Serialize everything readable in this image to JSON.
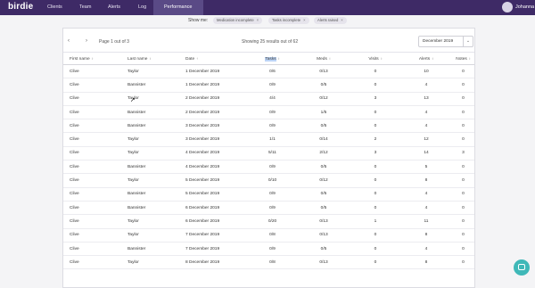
{
  "app": {
    "logo": "birdie",
    "user": "Johanna"
  },
  "nav": {
    "items": [
      "Clients",
      "Team",
      "Alerts",
      "Log",
      "Performance"
    ],
    "active": "Performance"
  },
  "filters": {
    "label": "Show me:",
    "chips": [
      "Medication incomplete",
      "Tasks incomplete",
      "Alerts raised"
    ]
  },
  "pager": {
    "prev_icon": "‹",
    "next_icon": "›",
    "text": "Page 1 out of 3",
    "showing": "Showing 25 results out of 62",
    "month": "December 2019",
    "month_caret": "⌄"
  },
  "table": {
    "headers": [
      "First name",
      "Last name",
      "Date",
      "Tasks",
      "Meds",
      "Visits",
      "Alerts",
      "Notes"
    ],
    "sort_icon": "↕",
    "date_sort_icon": "↑",
    "rows": [
      [
        "Clive",
        "Taylor",
        "1 December 2019",
        "0/6",
        "0/13",
        "0",
        "10",
        "0"
      ],
      [
        "Clive",
        "Bannister",
        "1 December 2019",
        "0/9",
        "0/5",
        "0",
        "4",
        "0"
      ],
      [
        "Clive",
        "Taylor",
        "2 December 2019",
        "4/4",
        "0/12",
        "3",
        "13",
        "0"
      ],
      [
        "Clive",
        "Bannister",
        "2 December 2019",
        "0/9",
        "1/5",
        "0",
        "4",
        "0"
      ],
      [
        "Clive",
        "Bannister",
        "3 December 2019",
        "0/9",
        "0/5",
        "0",
        "4",
        "0"
      ],
      [
        "Clive",
        "Taylor",
        "3 December 2019",
        "1/1",
        "0/14",
        "2",
        "12",
        "0"
      ],
      [
        "Clive",
        "Taylor",
        "4 December 2019",
        "5/11",
        "2/12",
        "3",
        "14",
        "3"
      ],
      [
        "Clive",
        "Bannister",
        "4 December 2019",
        "0/9",
        "0/5",
        "0",
        "5",
        "0"
      ],
      [
        "Clive",
        "Taylor",
        "5 December 2019",
        "0/10",
        "0/12",
        "0",
        "8",
        "0"
      ],
      [
        "Clive",
        "Bannister",
        "5 December 2019",
        "0/9",
        "0/5",
        "0",
        "4",
        "0"
      ],
      [
        "Clive",
        "Bannister",
        "6 December 2019",
        "0/9",
        "0/5",
        "0",
        "4",
        "0"
      ],
      [
        "Clive",
        "Taylor",
        "6 December 2019",
        "0/20",
        "0/13",
        "1",
        "11",
        "0"
      ],
      [
        "Clive",
        "Taylor",
        "7 December 2019",
        "0/8",
        "0/13",
        "0",
        "8",
        "0"
      ],
      [
        "Clive",
        "Bannister",
        "7 December 2019",
        "0/9",
        "0/5",
        "0",
        "4",
        "0"
      ],
      [
        "Clive",
        "Taylor",
        "8 December 2019",
        "0/8",
        "0/13",
        "0",
        "8",
        "0"
      ]
    ]
  },
  "colors": {
    "topbar": "#3e2a66",
    "accent": "#3fb8b8",
    "highlight": "#bcd4f6"
  },
  "icons": {
    "chat": "chat-bubble-icon",
    "cursor": "mouse-pointer-icon"
  }
}
